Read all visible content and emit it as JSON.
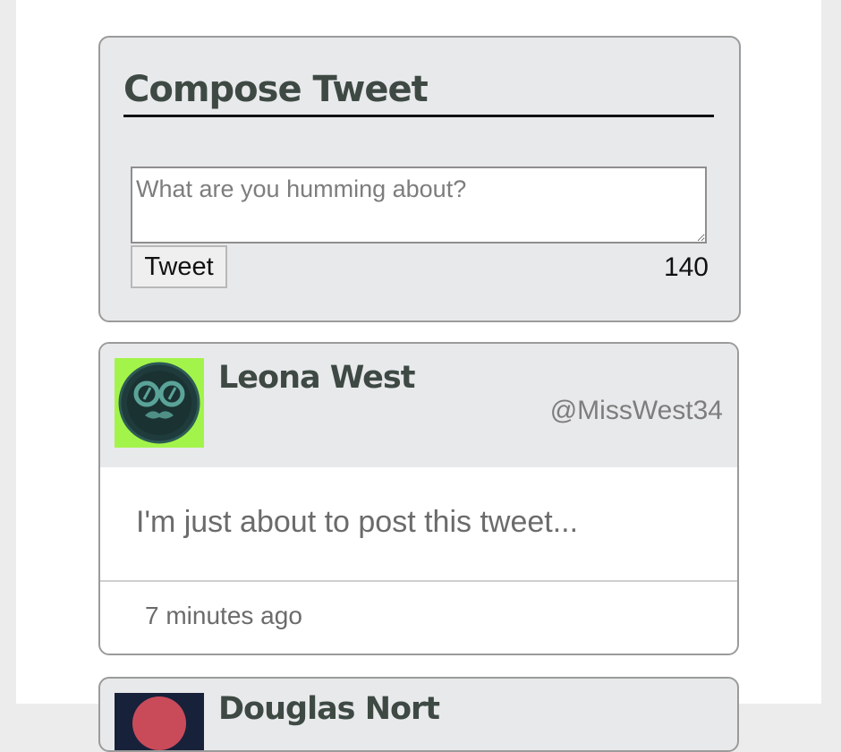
{
  "compose": {
    "title": "Compose Tweet",
    "placeholder": "What are you humming about?",
    "button_label": "Tweet",
    "char_count": "140"
  },
  "tweets": [
    {
      "name": "Leona West",
      "handle": "@MissWest34",
      "text": "I'm just about to post this tweet...",
      "time": "7 minutes ago",
      "avatar_icon": "glasses-mustache-face-icon",
      "avatar_bg": "#a3f44a",
      "avatar_fg": "#1f3b3b"
    },
    {
      "name": "Douglas Nort",
      "avatar_icon": "avatar-icon",
      "avatar_bg": "#18213a",
      "avatar_accent": "#c94b5a"
    }
  ],
  "colors": {
    "card_bg": "#e8e9eb",
    "card_border": "#9b9b9b",
    "heading_text": "#3e4944",
    "muted_text": "#7d7d7d"
  }
}
